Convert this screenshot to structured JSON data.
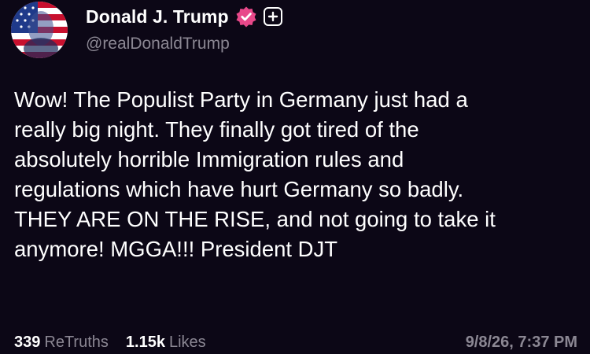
{
  "author": {
    "display_name": "Donald J. Trump",
    "handle": "@realDonaldTrump",
    "avatar_icon": "flag-portrait-avatar",
    "verified_icon": "verified-badge-icon",
    "follow_icon": "plus-icon"
  },
  "post": {
    "text": "Wow! The Populist Party in Germany just had a\nreally big night. They finally got tired of the\nabsolutely horrible Immigration rules and\nregulations which have hurt Germany so badly.\nTHEY ARE ON THE RISE, and not going to take it\nanymore! MGGA!!! President DJT"
  },
  "stats": {
    "retruths_count": "339",
    "retruths_label": "ReTruths",
    "likes_count": "1.15k",
    "likes_label": "Likes",
    "timestamp": "9/8/26, 7:37 PM"
  },
  "colors": {
    "background": "#0c0716",
    "verified_badge": "#e8488a",
    "secondary_text": "#8b8793"
  }
}
